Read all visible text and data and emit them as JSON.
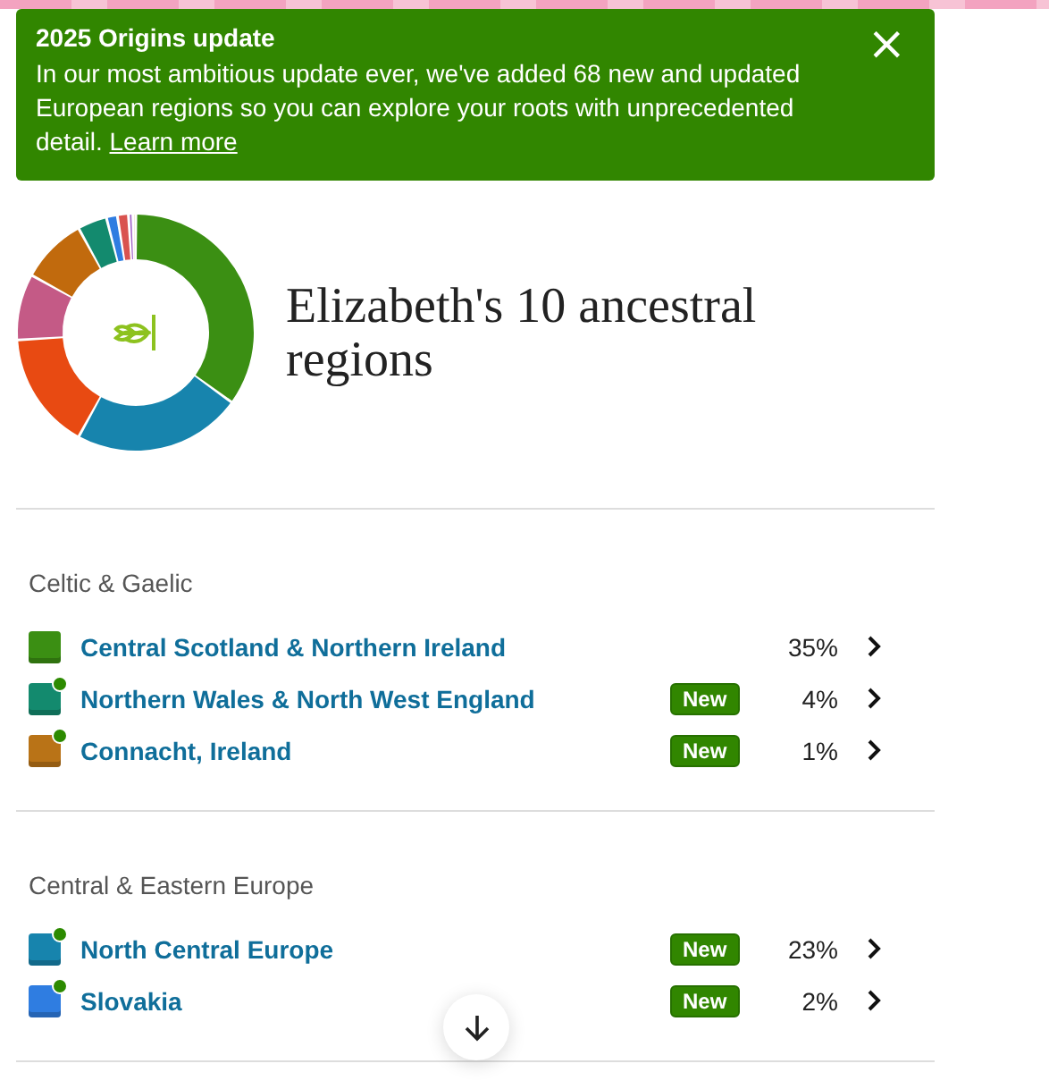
{
  "banner": {
    "title": "2025 Origins update",
    "text": "In our most ambitious update ever, we've added 68 new and updated European regions so you can explore your roots with unprecedented detail.",
    "link": "Learn more",
    "close": "×"
  },
  "heading": "Elizabeth's 10 ancestral regions",
  "sections": [
    {
      "title": "Celtic & Gaelic",
      "regions": [
        {
          "name": "Central Scotland & Northern Ireland",
          "percent": "35%",
          "new": false,
          "color": "#3b8f13"
        },
        {
          "name": "Northern Wales & North West England",
          "percent": "4%",
          "new": true,
          "badge": "New",
          "color": "#138a6e"
        },
        {
          "name": "Connacht, Ireland",
          "percent": "1%",
          "new": true,
          "badge": "New",
          "color": "#b97317"
        }
      ]
    },
    {
      "title": "Central & Eastern Europe",
      "regions": [
        {
          "name": "North Central Europe",
          "percent": "23%",
          "new": true,
          "badge": "New",
          "color": "#1784ad"
        },
        {
          "name": "Slovakia",
          "percent": "2%",
          "new": true,
          "badge": "New",
          "color": "#2f7de1"
        }
      ]
    }
  ]
}
